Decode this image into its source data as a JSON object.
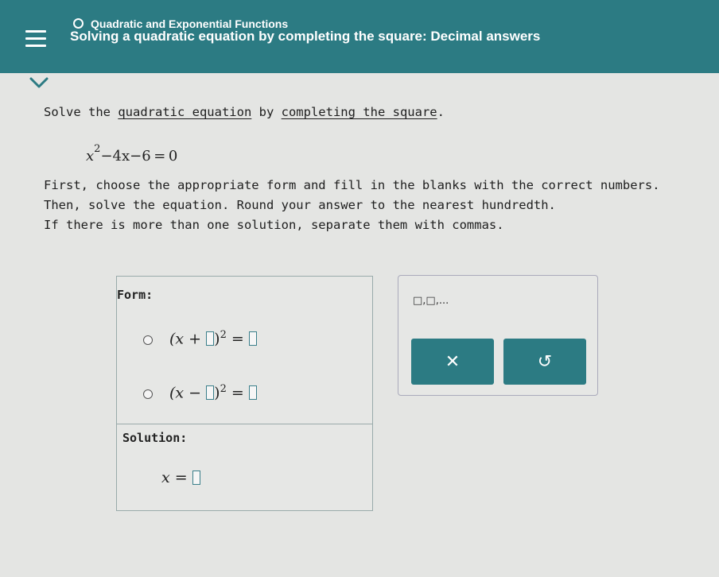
{
  "header": {
    "topic": "Quadratic and Exponential Functions",
    "lesson": "Solving a quadratic equation by completing the square: Decimal answers"
  },
  "problem": {
    "intro_pre": "Solve the ",
    "link1": "quadratic equation",
    "intro_mid": " by ",
    "link2": "completing the square",
    "intro_post": ".",
    "equation": {
      "base": "x",
      "exponent": "2",
      "rest": "−4x−6 = 0"
    },
    "instructions": [
      "First, choose the appropriate form and fill in the blanks with the correct numbers.",
      "Then, solve the equation. Round your answer to the nearest hundredth.",
      "If there is more than one solution, separate them with commas."
    ]
  },
  "answer_panel": {
    "form_label": "Form:",
    "option_plus": {
      "open": "(x +",
      "close": ")",
      "exponent": "2",
      "equals": "="
    },
    "option_minus": {
      "open": "(x −",
      "close": ")",
      "exponent": "2",
      "equals": "="
    },
    "solution_label": "Solution:",
    "solution_lhs": "x ="
  },
  "tools": {
    "list_key": "□,□,...",
    "clear_symbol": "✕",
    "undo_symbol": "↺"
  },
  "colors": {
    "accent": "#2c7b83",
    "background": "#e4e5e3"
  }
}
